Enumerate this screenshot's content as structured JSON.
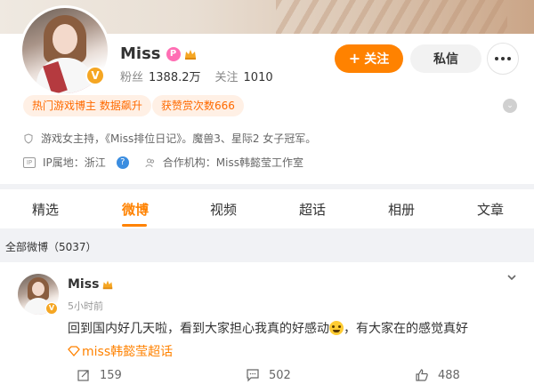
{
  "profile": {
    "name": "Miss",
    "followers_label": "粉丝",
    "followers_value": "1388.2万",
    "following_label": "关注",
    "following_value": "1010",
    "follow_button": "关注",
    "message_button": "私信",
    "tags": [
      "热门游戏博主 数据飙升",
      "获赞赏次数666"
    ],
    "bio": "游戏女主持，《Miss排位日记》。魔兽3、星际2 女子冠军。",
    "ip_label": "IP属地：浙江",
    "agency": "合作机构：Miss韩懿莹工作室",
    "accent_color": "#ff8200"
  },
  "tabs": [
    "精选",
    "微博",
    "视频",
    "超话",
    "相册",
    "文章"
  ],
  "active_tab": "微博",
  "all_posts_label": "全部微博（5037）",
  "post": {
    "author": "Miss",
    "time": "5小时前",
    "text_before_emoji": "回到国内好几天啦，看到大家担心我真的好感动",
    "text_after_emoji": "，有大家在的感觉真好",
    "topic": "miss韩懿莹超话",
    "reposts": "159",
    "comments": "502",
    "likes": "488"
  }
}
